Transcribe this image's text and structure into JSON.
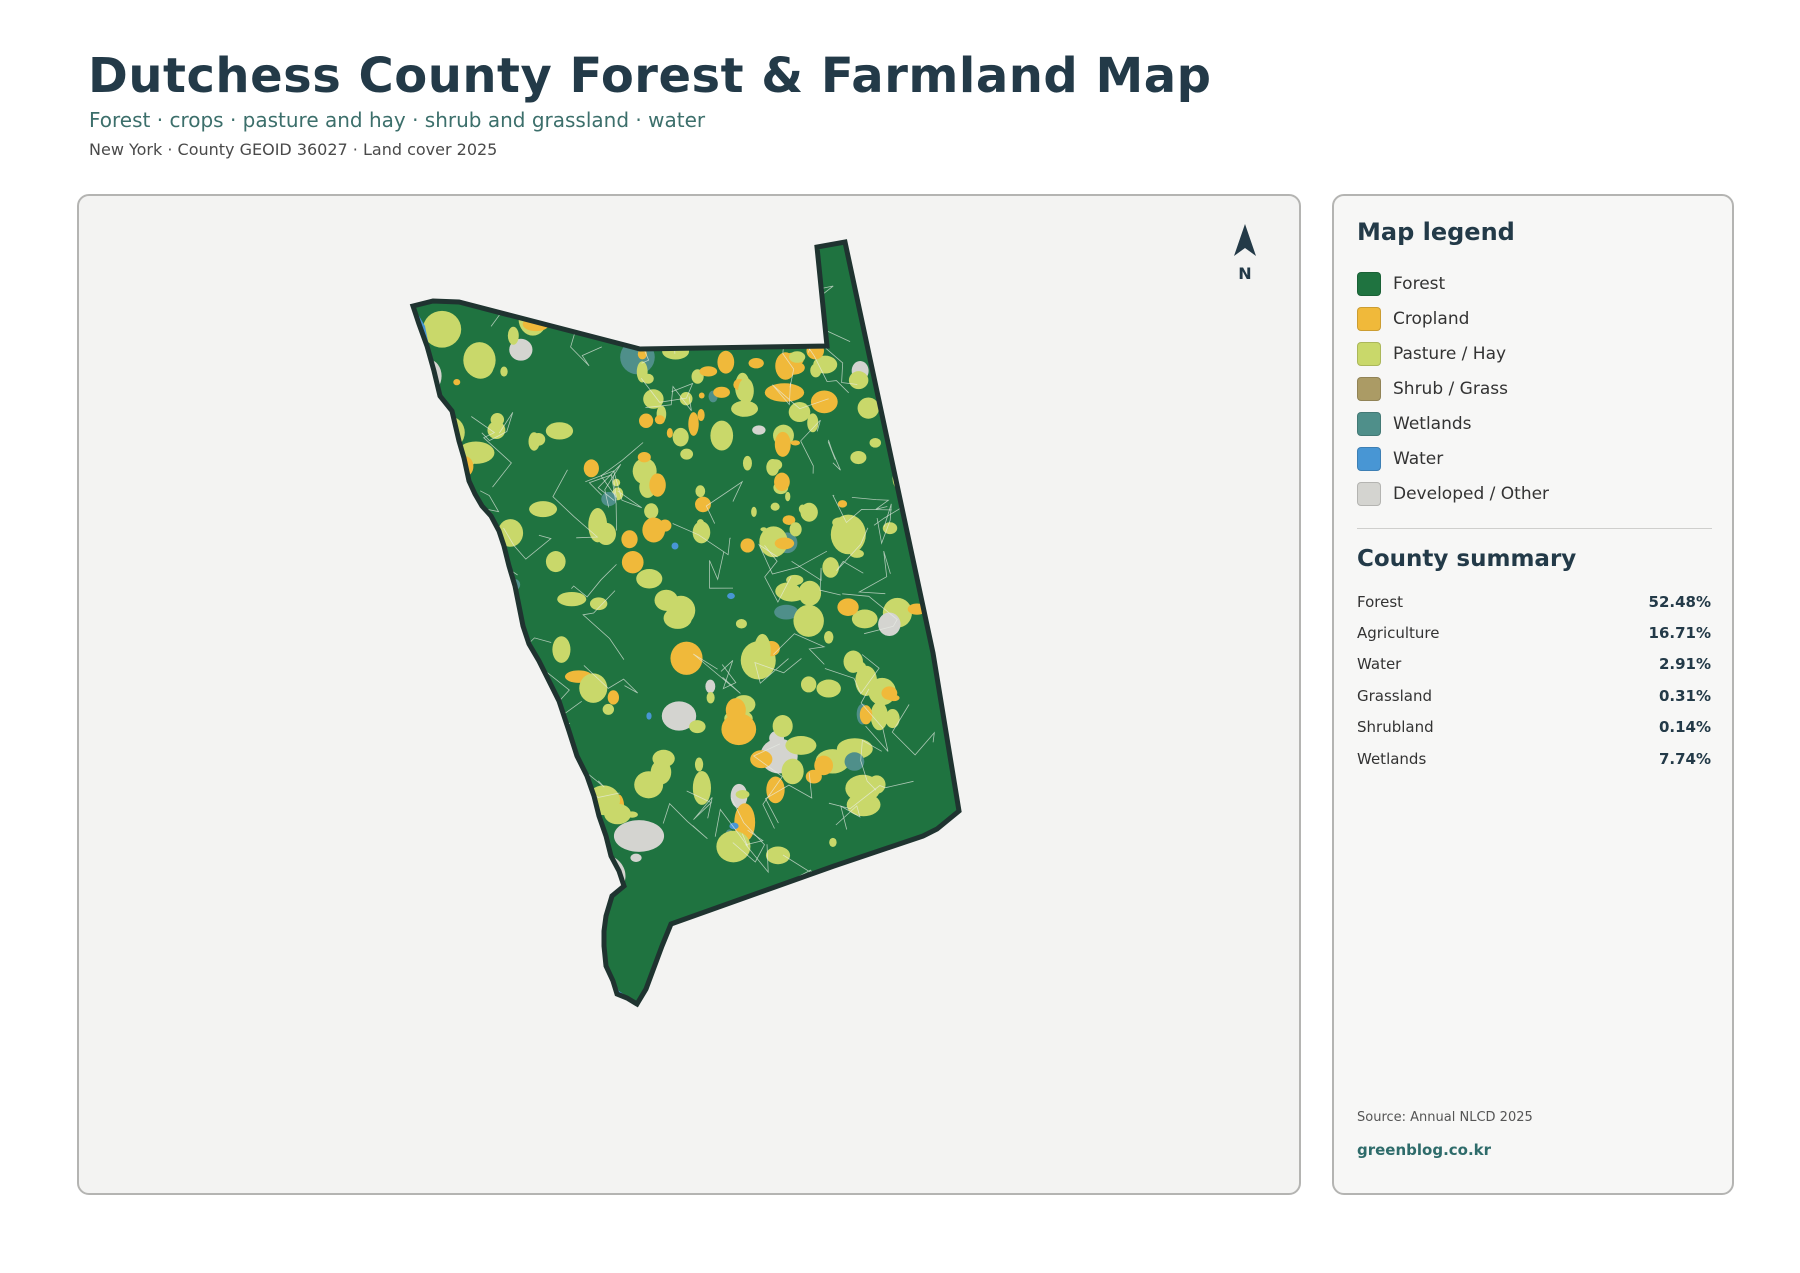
{
  "header": {
    "title": "Dutchess County Forest & Farmland Map",
    "subtitle": "Forest · crops · pasture and hay · shrub and grassland · water",
    "meta": "New York · County GEOID 36027 · Land cover 2025"
  },
  "map": {
    "north_label": "N",
    "north_icon": "north-arrow-icon",
    "colors": {
      "forest": "#1f7340",
      "cropland": "#f0b93a",
      "pasture": "#c9d86a",
      "shrub": "#ab9b65",
      "wetlands": "#4f8f8a",
      "water": "#4896d4",
      "developed": "#d4d4d0",
      "boundary": "#1f3330"
    }
  },
  "legend": {
    "title": "Map legend",
    "items": [
      {
        "label": "Forest",
        "color": "#1f7340"
      },
      {
        "label": "Cropland",
        "color": "#f0b93a"
      },
      {
        "label": "Pasture / Hay",
        "color": "#c9d86a"
      },
      {
        "label": "Shrub / Grass",
        "color": "#ab9b65"
      },
      {
        "label": "Wetlands",
        "color": "#4f8f8a"
      },
      {
        "label": "Water",
        "color": "#4896d4"
      },
      {
        "label": "Developed / Other",
        "color": "#d4d4d0"
      }
    ]
  },
  "summary": {
    "title": "County summary",
    "rows": [
      {
        "name": "Forest",
        "value": "52.48%"
      },
      {
        "name": "Agriculture",
        "value": "16.71%"
      },
      {
        "name": "Water",
        "value": "2.91%"
      },
      {
        "name": "Grassland",
        "value": "0.31%"
      },
      {
        "name": "Shrubland",
        "value": "0.14%"
      },
      {
        "name": "Wetlands",
        "value": "7.74%"
      }
    ]
  },
  "footer": {
    "source": "Source: Annual NLCD 2025",
    "site": "greenblog.co.kr"
  }
}
